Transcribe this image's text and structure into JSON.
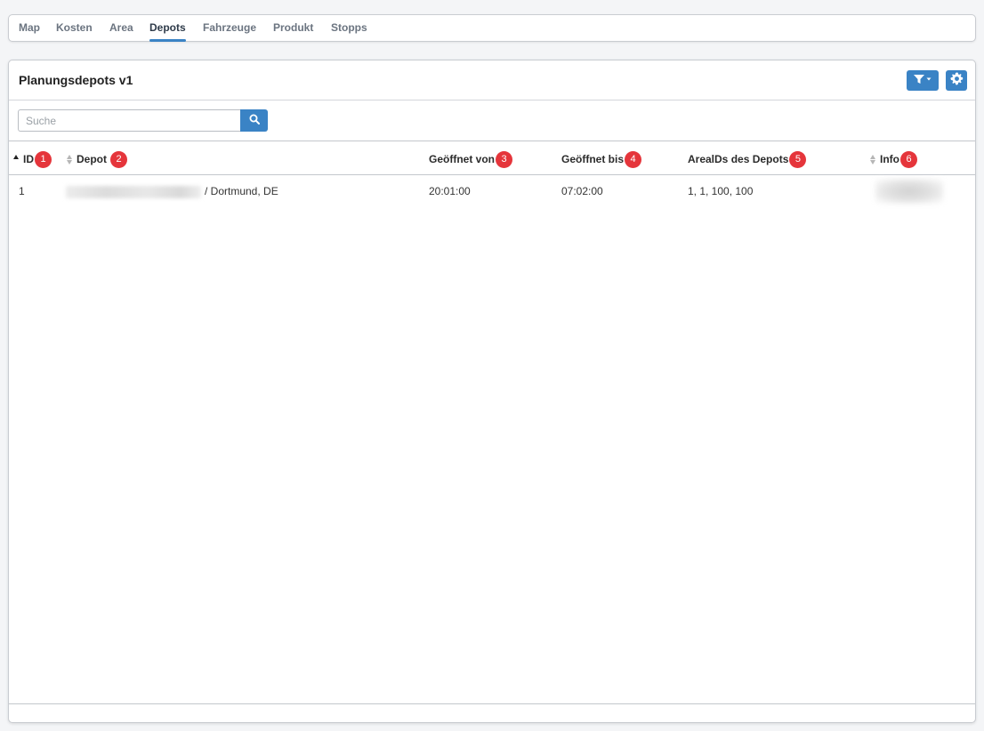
{
  "tabs": [
    {
      "label": "Map",
      "active": false
    },
    {
      "label": "Kosten",
      "active": false
    },
    {
      "label": "Area",
      "active": false
    },
    {
      "label": "Depots",
      "active": true
    },
    {
      "label": "Fahrzeuge",
      "active": false
    },
    {
      "label": "Produkt",
      "active": false
    },
    {
      "label": "Stopps",
      "active": false
    }
  ],
  "panel": {
    "title": "Planungsdepots v1",
    "filter_icon": "filter-icon",
    "settings_icon": "gear-icon"
  },
  "search": {
    "placeholder": "Suche",
    "value": "",
    "icon": "search-icon"
  },
  "table": {
    "columns": [
      {
        "label": "ID",
        "badge": "1",
        "sortable": true,
        "sort": "asc"
      },
      {
        "label": "Depot",
        "badge": "2",
        "sortable": true,
        "sort": "none"
      },
      {
        "label": "Geöffnet von",
        "badge": "3",
        "sortable": false
      },
      {
        "label": "Geöffnet bis",
        "badge": "4",
        "sortable": false
      },
      {
        "label": "ArealDs des Depots",
        "badge": "5",
        "sortable": false
      },
      {
        "label": "Info",
        "badge": "6",
        "sortable": true,
        "sort": "none"
      }
    ],
    "rows": [
      {
        "id": "1",
        "depot": "/ Dortmund, DE",
        "open_from": "20:01:00",
        "open_to": "07:02:00",
        "area_ids": "1, 1, 100, 100",
        "info": ""
      }
    ]
  },
  "colors": {
    "accent": "#3a83c5",
    "badge": "#e5353b"
  }
}
